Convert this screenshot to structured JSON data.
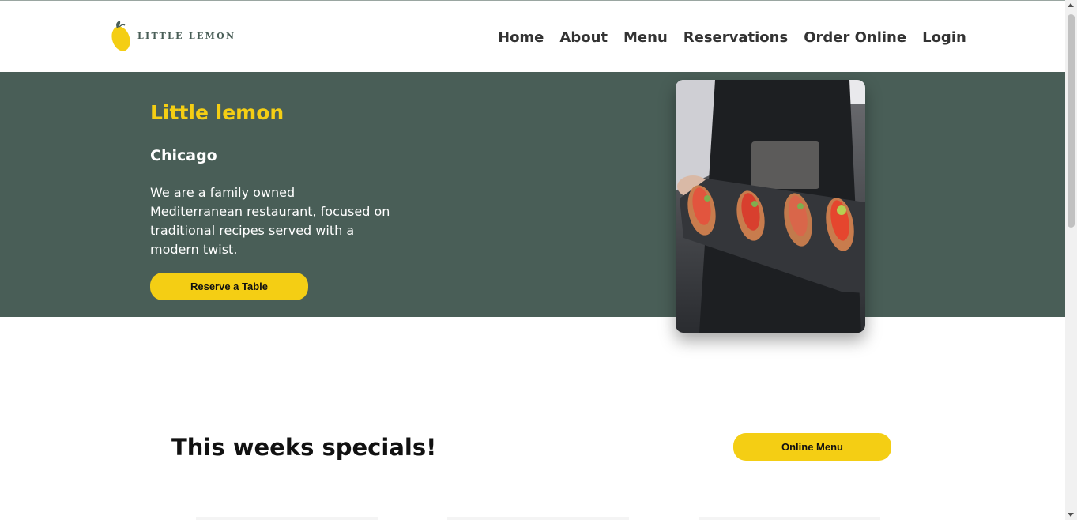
{
  "header": {
    "logo_text": "LITTLE LEMON",
    "nav": [
      "Home",
      "About",
      "Menu",
      "Reservations",
      "Order Online",
      "Login"
    ]
  },
  "hero": {
    "title": "Little lemon",
    "subtitle": "Chicago",
    "description": "We are a family owned Mediterranean restaurant, focused on traditional recipes served with a modern twist.",
    "cta_label": "Reserve a Table"
  },
  "specials": {
    "title": "This weeks specials!",
    "menu_button_label": "Online Menu"
  },
  "colors": {
    "primary_green": "#495e57",
    "primary_yellow": "#f4ce14"
  }
}
